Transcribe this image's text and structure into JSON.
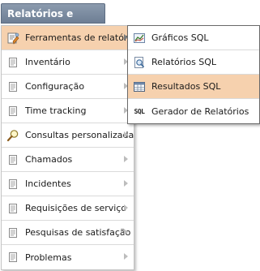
{
  "menu": {
    "title": "Relatórios e gráficos",
    "items": [
      {
        "label": "Ferramentas de relatório",
        "icon": "report-tools-icon",
        "active": true
      },
      {
        "label": "Inventário",
        "icon": "document-icon"
      },
      {
        "label": "Configuração",
        "icon": "document-icon"
      },
      {
        "label": "Time tracking",
        "icon": "document-icon"
      },
      {
        "label": "Consultas personalizadas",
        "icon": "magnifier-icon"
      },
      {
        "label": "Chamados",
        "icon": "document-icon"
      },
      {
        "label": "Incidentes",
        "icon": "document-icon"
      },
      {
        "label": "Requisições de serviço",
        "icon": "document-icon"
      },
      {
        "label": "Pesquisas de satisfação",
        "icon": "document-icon"
      },
      {
        "label": "Problemas",
        "icon": "document-icon"
      }
    ]
  },
  "submenu": {
    "items": [
      {
        "label": "Gráficos SQL",
        "icon": "chart-icon"
      },
      {
        "label": "Relatórios SQL",
        "icon": "report-search-icon"
      },
      {
        "label": "Resultados SQL",
        "icon": "table-icon",
        "active": true
      },
      {
        "label": "Gerador de Relatórios",
        "icon": "sql-icon",
        "icon_text": "SQL"
      }
    ]
  },
  "colors": {
    "title_bar": "#7d8ca1",
    "highlight": "#f6d1ae",
    "arrow": "#bdbdbd"
  }
}
